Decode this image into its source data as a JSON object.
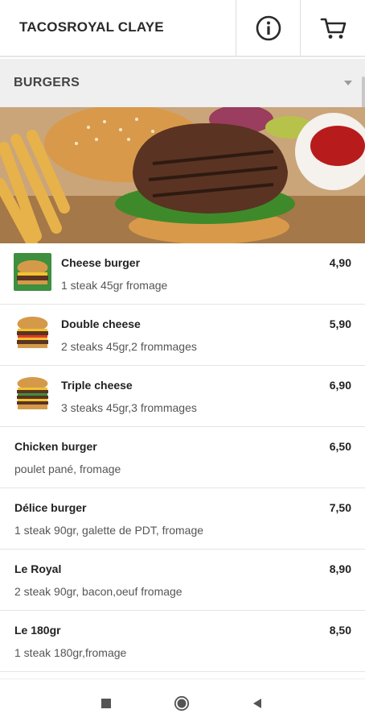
{
  "header": {
    "title": "TACOSROYAL CLAYE",
    "info_icon": "info-circle-icon",
    "cart_icon": "shopping-cart-icon"
  },
  "category": {
    "label": "BURGERS",
    "caret_icon": "caret-down-icon"
  },
  "menu": {
    "items": [
      {
        "name": "Cheese burger",
        "desc": "1 steak 45gr fromage",
        "price": "4,90",
        "thumb": "cheeseburger-thumbnail"
      },
      {
        "name": "Double cheese",
        "desc": "2 steaks 45gr,2 frommages",
        "price": "5,90",
        "thumb": "double-cheese-thumbnail"
      },
      {
        "name": "Triple cheese",
        "desc": "3 steaks 45gr,3 frommages",
        "price": "6,90",
        "thumb": "triple-cheese-thumbnail"
      },
      {
        "name": "Chicken burger",
        "desc": "poulet pané, fromage",
        "price": "6,50"
      },
      {
        "name": "Délice burger",
        "desc": "1 steak 90gr, galette de PDT, fromage",
        "price": "7,50"
      },
      {
        "name": "Le Royal",
        "desc": "2 steak 90gr, bacon,oeuf fromage",
        "price": "8,90"
      },
      {
        "name": "Le 180gr",
        "desc": "1 steak 180gr,fromage",
        "price": "8,50"
      }
    ]
  },
  "navbar": {
    "recents_icon": "square-icon",
    "home_icon": "home-circle-icon",
    "back_icon": "back-triangle-icon"
  },
  "colors": {
    "header_bg": "#ffffff",
    "category_bg": "#efefef",
    "text_dark": "#222222",
    "text_muted": "#555555"
  }
}
